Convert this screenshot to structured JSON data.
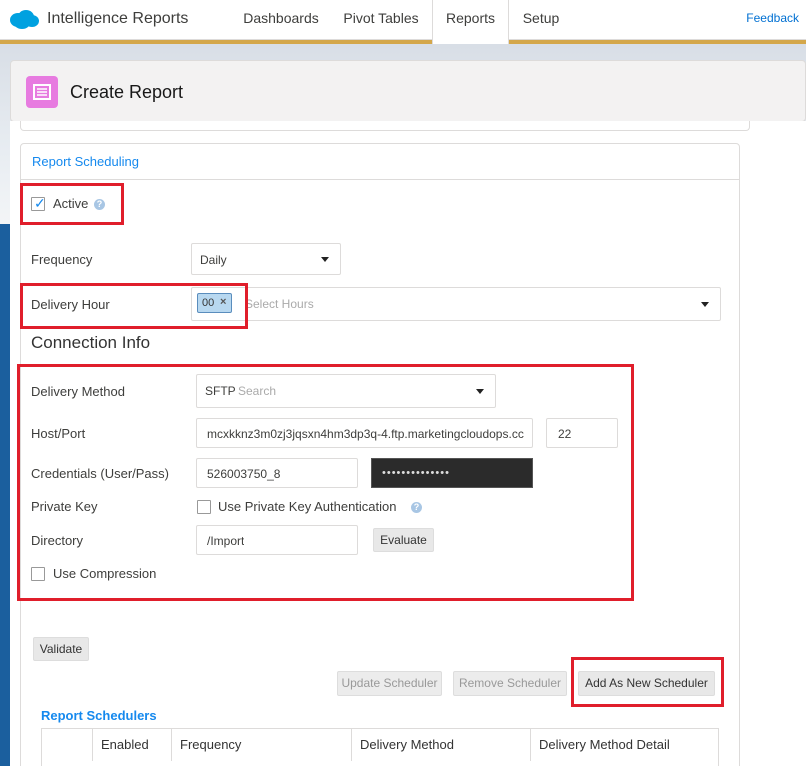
{
  "nav": {
    "app_title": "Intelligence Reports",
    "tabs": [
      {
        "label": "Dashboards"
      },
      {
        "label": "Pivot Tables"
      },
      {
        "label": "Reports"
      },
      {
        "label": "Setup"
      }
    ],
    "feedback": "Feedback"
  },
  "page": {
    "title": "Create Report"
  },
  "scheduling": {
    "title": "Report Scheduling",
    "active_label": "Active",
    "active_checked": true,
    "frequency_label": "Frequency",
    "frequency_value": "Daily",
    "delivery_hour_label": "Delivery Hour",
    "delivery_hour_tag": "00",
    "delivery_hour_placeholder": "Select Hours"
  },
  "connection": {
    "title": "Connection Info",
    "delivery_method_label": "Delivery Method",
    "delivery_method_value": "SFTP",
    "delivery_method_placeholder": "Search",
    "host_port_label": "Host/Port",
    "host_value": "mcxkknz3m0zj3jqsxn4hm3dp3q-4.ftp.marketingcloudops.cc",
    "port_value": "22",
    "credentials_label": "Credentials (User/Pass)",
    "user_value": "526003750_8",
    "password_mask": "••••••••••••••",
    "private_key_label": "Private Key",
    "private_key_option": "Use Private Key Authentication",
    "directory_label": "Directory",
    "directory_value": "/Import",
    "evaluate_label": "Evaluate",
    "use_compression_label": "Use Compression"
  },
  "actions": {
    "validate": "Validate",
    "update_scheduler": "Update Scheduler",
    "remove_scheduler": "Remove Scheduler",
    "add_new_scheduler": "Add As New Scheduler"
  },
  "schedulers": {
    "title": "Report Schedulers",
    "columns": [
      "",
      "Enabled",
      "Frequency",
      "Delivery Method",
      "Delivery Method Detail"
    ]
  },
  "colors": {
    "accent": "#1589ee",
    "highlight": "#e01e2b",
    "icon_bg": "#e77be0"
  }
}
